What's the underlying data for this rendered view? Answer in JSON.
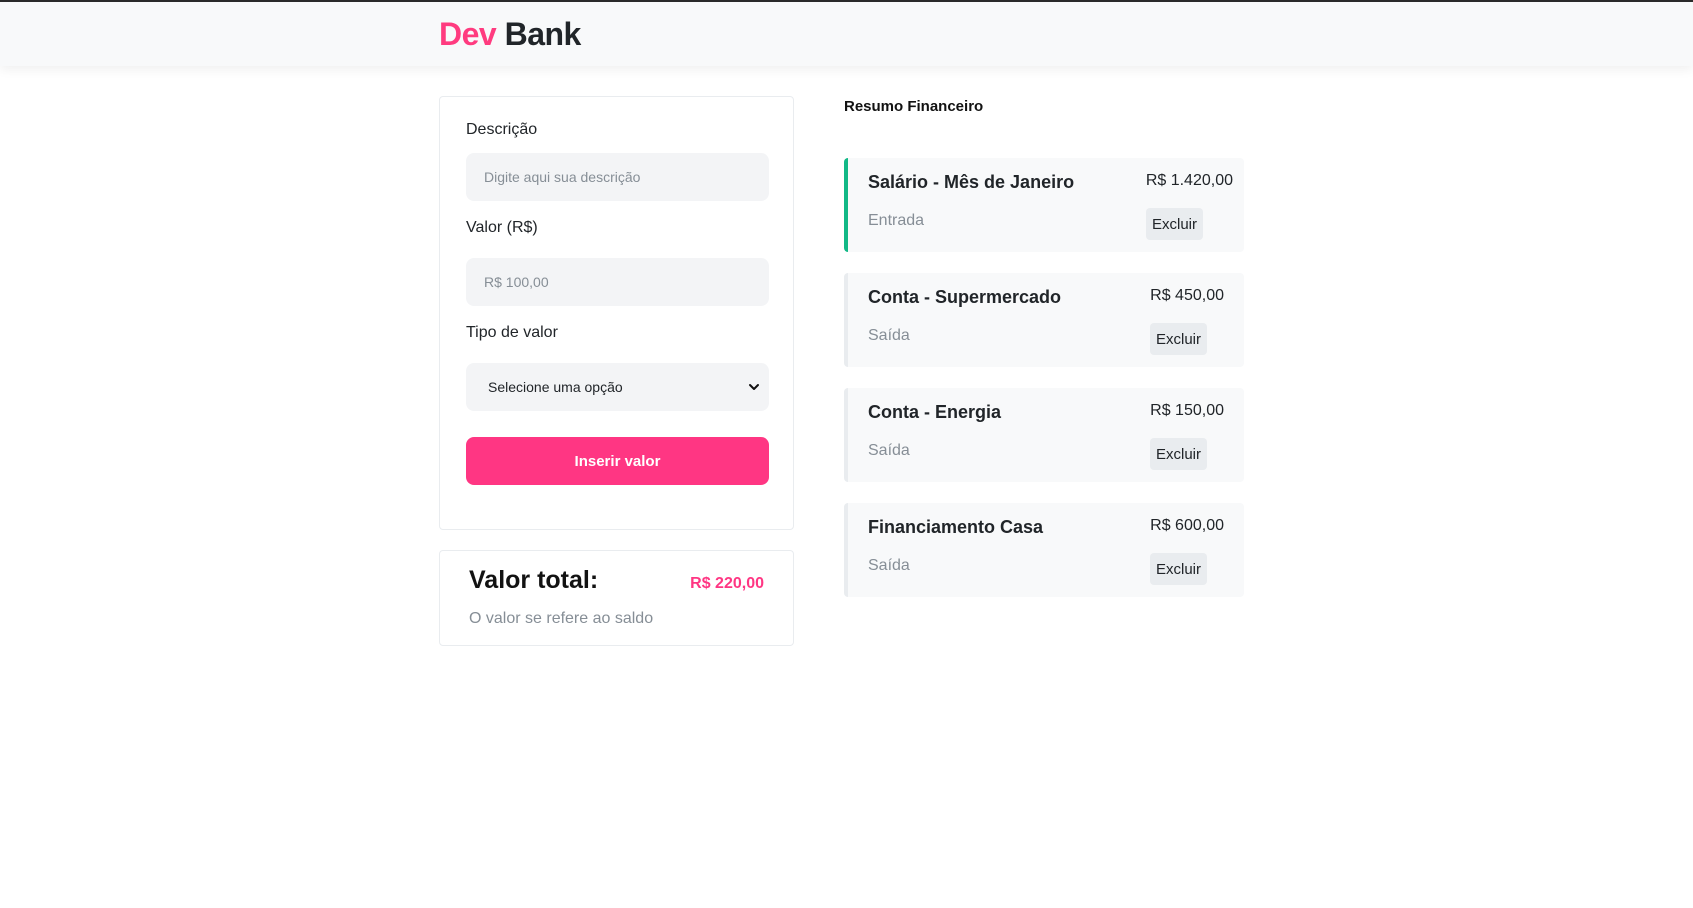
{
  "header": {
    "logo_part1": "Dev",
    "logo_part2": "Bank"
  },
  "form": {
    "description_label": "Descrição",
    "description_placeholder": "Digite aqui sua descrição",
    "value_label": "Valor (R$)",
    "value_placeholder": "R$ 100,00",
    "type_label": "Tipo de valor",
    "type_selected": "Selecione uma opção",
    "submit_label": "Inserir valor"
  },
  "total": {
    "title": "Valor total:",
    "value": "R$ 220,00",
    "note": "O valor se refere ao saldo"
  },
  "summary": {
    "title": "Resumo Financeiro",
    "entries": [
      {
        "name": "Salário - Mês de Janeiro",
        "type": "Entrada",
        "value": "R$ 1.420,00",
        "delete_label": "Excluir"
      },
      {
        "name": "Conta - Supermercado",
        "type": "Saída",
        "value": "R$ 450,00",
        "delete_label": "Excluir"
      },
      {
        "name": "Conta - Energia",
        "type": "Saída",
        "value": "R$ 150,00",
        "delete_label": "Excluir"
      },
      {
        "name": "Financiamento Casa",
        "type": "Saída",
        "value": "R$ 600,00",
        "delete_label": "Excluir"
      }
    ]
  },
  "colors": {
    "brand_pink": "#ff3683",
    "income_green": "#12b886",
    "muted_text": "#868e96"
  }
}
